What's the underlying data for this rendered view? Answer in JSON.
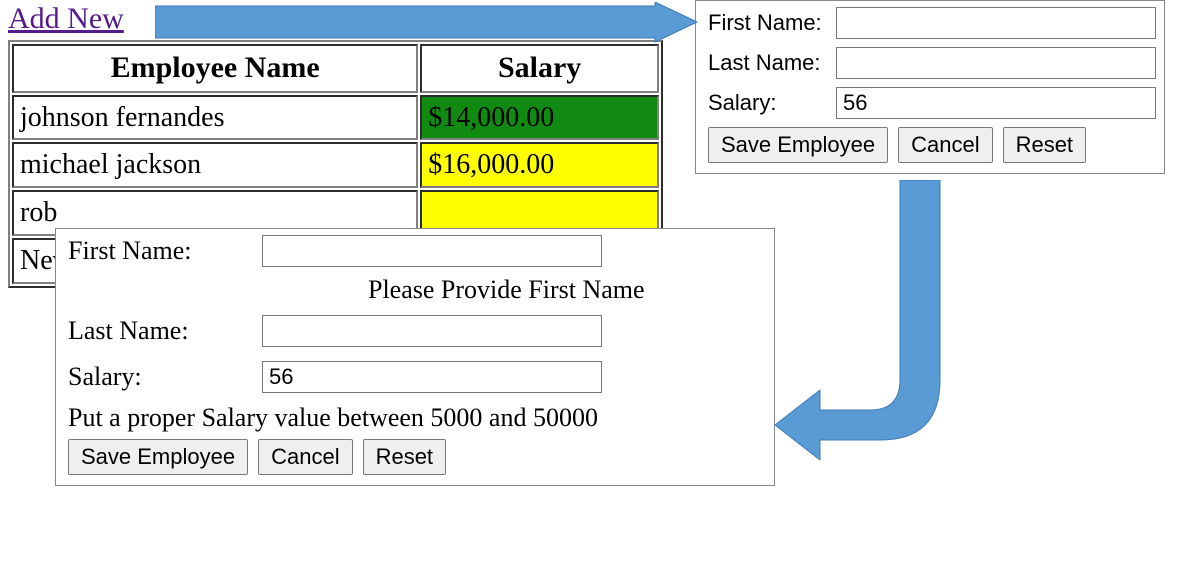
{
  "add_new_label": "Add New",
  "table": {
    "headers": {
      "name": "Employee Name",
      "salary": "Salary"
    },
    "rows": [
      {
        "name": "johnson fernandes",
        "salary": "$14,000.00",
        "salary_class": "salary-green"
      },
      {
        "name": "michael jackson",
        "salary": "$16,000.00",
        "salary_class": "salary-yellow"
      },
      {
        "name": "rob",
        "salary": "",
        "salary_class": "salary-yellow"
      },
      {
        "name": "Nev",
        "salary": "",
        "salary_class": ""
      }
    ]
  },
  "form_a": {
    "first_name_label": "First Name:",
    "last_name_label": "Last Name:",
    "salary_label": "Salary:",
    "first_name_value": "",
    "last_name_value": "",
    "salary_value": "56",
    "save_label": "Save Employee",
    "cancel_label": "Cancel",
    "reset_label": "Reset"
  },
  "form_b": {
    "first_name_label": "First Name:",
    "last_name_label": "Last Name:",
    "salary_label": "Salary:",
    "first_name_value": "",
    "last_name_value": "",
    "salary_value": "56",
    "first_name_validation": "Please Provide First Name",
    "salary_validation": "Put a proper Salary value between 5000 and 50000",
    "save_label": "Save Employee",
    "cancel_label": "Cancel",
    "reset_label": "Reset"
  },
  "colors": {
    "link_visited": "#551A8B",
    "salary_green": "#118a11",
    "salary_yellow": "#ffff00",
    "arrow": "#5B9BD5"
  }
}
